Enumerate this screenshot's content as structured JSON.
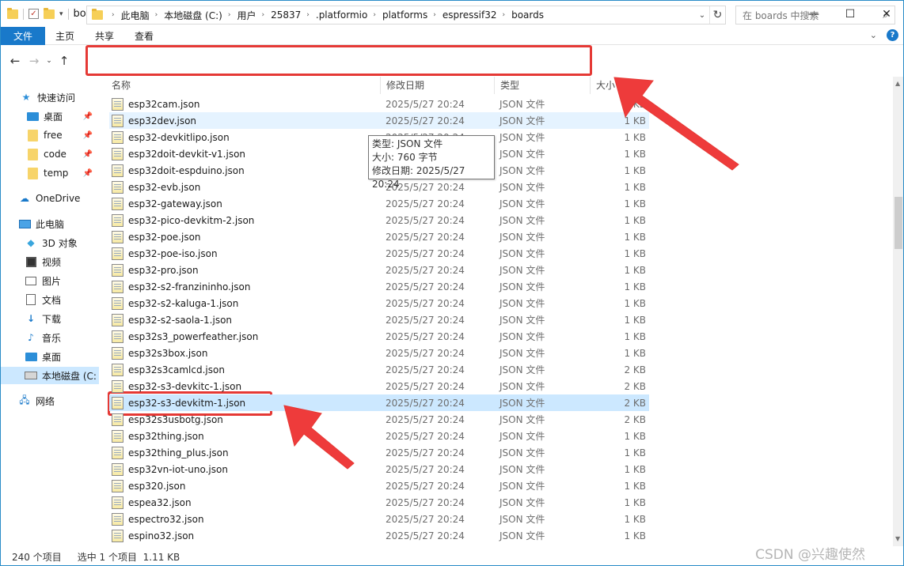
{
  "window": {
    "title": "boards"
  },
  "ribbon": {
    "tabs": [
      "文件",
      "主页",
      "共享",
      "查看"
    ]
  },
  "address": {
    "crumbs": [
      "此电脑",
      "本地磁盘 (C:)",
      "用户",
      "25837",
      ".platformio",
      "platforms",
      "espressif32",
      "boards"
    ]
  },
  "search": {
    "placeholder": "在 boards 中搜索"
  },
  "nav": {
    "items": [
      {
        "label": "快速访问",
        "icon": "star-icon"
      },
      {
        "label": "桌面",
        "icon": "desktop-icon",
        "pinned": true
      },
      {
        "label": "free",
        "icon": "folder-icon",
        "pinned": true
      },
      {
        "label": "code",
        "icon": "folder-icon",
        "pinned": true
      },
      {
        "label": "temp",
        "icon": "folder-icon",
        "pinned": true
      },
      {
        "label": "OneDrive",
        "icon": "cloud-icon"
      },
      {
        "label": "此电脑",
        "icon": "computer-icon"
      },
      {
        "label": "3D 对象",
        "icon": "cube-icon"
      },
      {
        "label": "视频",
        "icon": "video-icon"
      },
      {
        "label": "图片",
        "icon": "picture-icon"
      },
      {
        "label": "文档",
        "icon": "document-icon"
      },
      {
        "label": "下载",
        "icon": "download-icon"
      },
      {
        "label": "音乐",
        "icon": "music-icon"
      },
      {
        "label": "桌面",
        "icon": "desktop-icon"
      },
      {
        "label": "本地磁盘 (C:",
        "icon": "drive-icon",
        "selected": true
      },
      {
        "label": "网络",
        "icon": "network-icon"
      }
    ]
  },
  "columns": {
    "name": "名称",
    "date": "修改日期",
    "type": "类型",
    "size": "大小"
  },
  "files": [
    {
      "name": "esp32cam.json",
      "date": "2025/5/27 20:24",
      "type": "JSON 文件",
      "size": "1 KB"
    },
    {
      "name": "esp32dev.json",
      "date": "2025/5/27 20:24",
      "type": "JSON 文件",
      "size": "1 KB",
      "hover": true
    },
    {
      "name": "esp32-devkitlipo.json",
      "date": "2025/5/27 20:24",
      "type": "JSON 文件",
      "size": "1 KB"
    },
    {
      "name": "esp32doit-devkit-v1.json",
      "date": "2025/5/27 20:24",
      "type": "JSON 文件",
      "size": "1 KB"
    },
    {
      "name": "esp32doit-espduino.json",
      "date": "2025/5/27 20:24",
      "type": "JSON 文件",
      "size": "1 KB"
    },
    {
      "name": "esp32-evb.json",
      "date": "2025/5/27 20:24",
      "type": "JSON 文件",
      "size": "1 KB"
    },
    {
      "name": "esp32-gateway.json",
      "date": "2025/5/27 20:24",
      "type": "JSON 文件",
      "size": "1 KB"
    },
    {
      "name": "esp32-pico-devkitm-2.json",
      "date": "2025/5/27 20:24",
      "type": "JSON 文件",
      "size": "1 KB"
    },
    {
      "name": "esp32-poe.json",
      "date": "2025/5/27 20:24",
      "type": "JSON 文件",
      "size": "1 KB"
    },
    {
      "name": "esp32-poe-iso.json",
      "date": "2025/5/27 20:24",
      "type": "JSON 文件",
      "size": "1 KB"
    },
    {
      "name": "esp32-pro.json",
      "date": "2025/5/27 20:24",
      "type": "JSON 文件",
      "size": "1 KB"
    },
    {
      "name": "esp32-s2-franzininho.json",
      "date": "2025/5/27 20:24",
      "type": "JSON 文件",
      "size": "1 KB"
    },
    {
      "name": "esp32-s2-kaluga-1.json",
      "date": "2025/5/27 20:24",
      "type": "JSON 文件",
      "size": "1 KB"
    },
    {
      "name": "esp32-s2-saola-1.json",
      "date": "2025/5/27 20:24",
      "type": "JSON 文件",
      "size": "1 KB"
    },
    {
      "name": "esp32s3_powerfeather.json",
      "date": "2025/5/27 20:24",
      "type": "JSON 文件",
      "size": "1 KB"
    },
    {
      "name": "esp32s3box.json",
      "date": "2025/5/27 20:24",
      "type": "JSON 文件",
      "size": "1 KB"
    },
    {
      "name": "esp32s3camlcd.json",
      "date": "2025/5/27 20:24",
      "type": "JSON 文件",
      "size": "2 KB"
    },
    {
      "name": "esp32-s3-devkitc-1.json",
      "date": "2025/5/27 20:24",
      "type": "JSON 文件",
      "size": "2 KB"
    },
    {
      "name": "esp32-s3-devkitm-1.json",
      "date": "2025/5/27 20:24",
      "type": "JSON 文件",
      "size": "2 KB",
      "selected": true
    },
    {
      "name": "esp32s3usbotg.json",
      "date": "2025/5/27 20:24",
      "type": "JSON 文件",
      "size": "2 KB"
    },
    {
      "name": "esp32thing.json",
      "date": "2025/5/27 20:24",
      "type": "JSON 文件",
      "size": "1 KB"
    },
    {
      "name": "esp32thing_plus.json",
      "date": "2025/5/27 20:24",
      "type": "JSON 文件",
      "size": "1 KB"
    },
    {
      "name": "esp32vn-iot-uno.json",
      "date": "2025/5/27 20:24",
      "type": "JSON 文件",
      "size": "1 KB"
    },
    {
      "name": "esp320.json",
      "date": "2025/5/27 20:24",
      "type": "JSON 文件",
      "size": "1 KB"
    },
    {
      "name": "espea32.json",
      "date": "2025/5/27 20:24",
      "type": "JSON 文件",
      "size": "1 KB"
    },
    {
      "name": "espectro32.json",
      "date": "2025/5/27 20:24",
      "type": "JSON 文件",
      "size": "1 KB"
    },
    {
      "name": "espino32.json",
      "date": "2025/5/27 20:24",
      "type": "JSON 文件",
      "size": "1 KB"
    }
  ],
  "tooltip": {
    "type_line": "类型: JSON 文件",
    "size_line": "大小: 760 字节",
    "date_line": "修改日期: 2025/5/27 20:24"
  },
  "status": {
    "count": "240 个项目",
    "selection": "选中 1 个项目  1.11 KB"
  },
  "watermark": "CSDN @兴趣使然",
  "colors": {
    "accent": "#1979ca",
    "selection": "#cce8ff",
    "highlight": "#e53935"
  }
}
